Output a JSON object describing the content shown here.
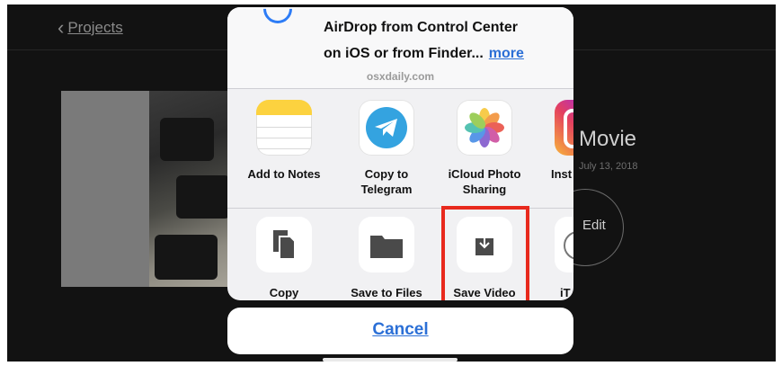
{
  "nav": {
    "back_label": "Projects"
  },
  "project": {
    "title": "Movie",
    "date": "July 13, 2018",
    "edit_label": "Edit"
  },
  "share_sheet": {
    "header": {
      "line1": "AirDrop from Control Center",
      "line2": "on iOS or from Finder...",
      "more_label": "more",
      "site": "osxdaily.com"
    },
    "apps": [
      {
        "label": "Add to Notes",
        "icon": "notes-icon"
      },
      {
        "label": "Copy to Telegram",
        "icon": "telegram-icon"
      },
      {
        "label": "iCloud Photo Sharing",
        "icon": "photos-icon"
      },
      {
        "label": "Inst",
        "icon": "instagram-icon"
      }
    ],
    "actions": [
      {
        "label": "Copy",
        "icon": "copy-icon"
      },
      {
        "label": "Save to Files",
        "icon": "folder-icon"
      },
      {
        "label": "Save Video",
        "icon": "save-video-icon"
      },
      {
        "label": "iT",
        "icon": "itunes-icon"
      }
    ],
    "cancel_label": "Cancel",
    "highlight_color": "#e8291d",
    "link_color": "#2b6fd6"
  }
}
